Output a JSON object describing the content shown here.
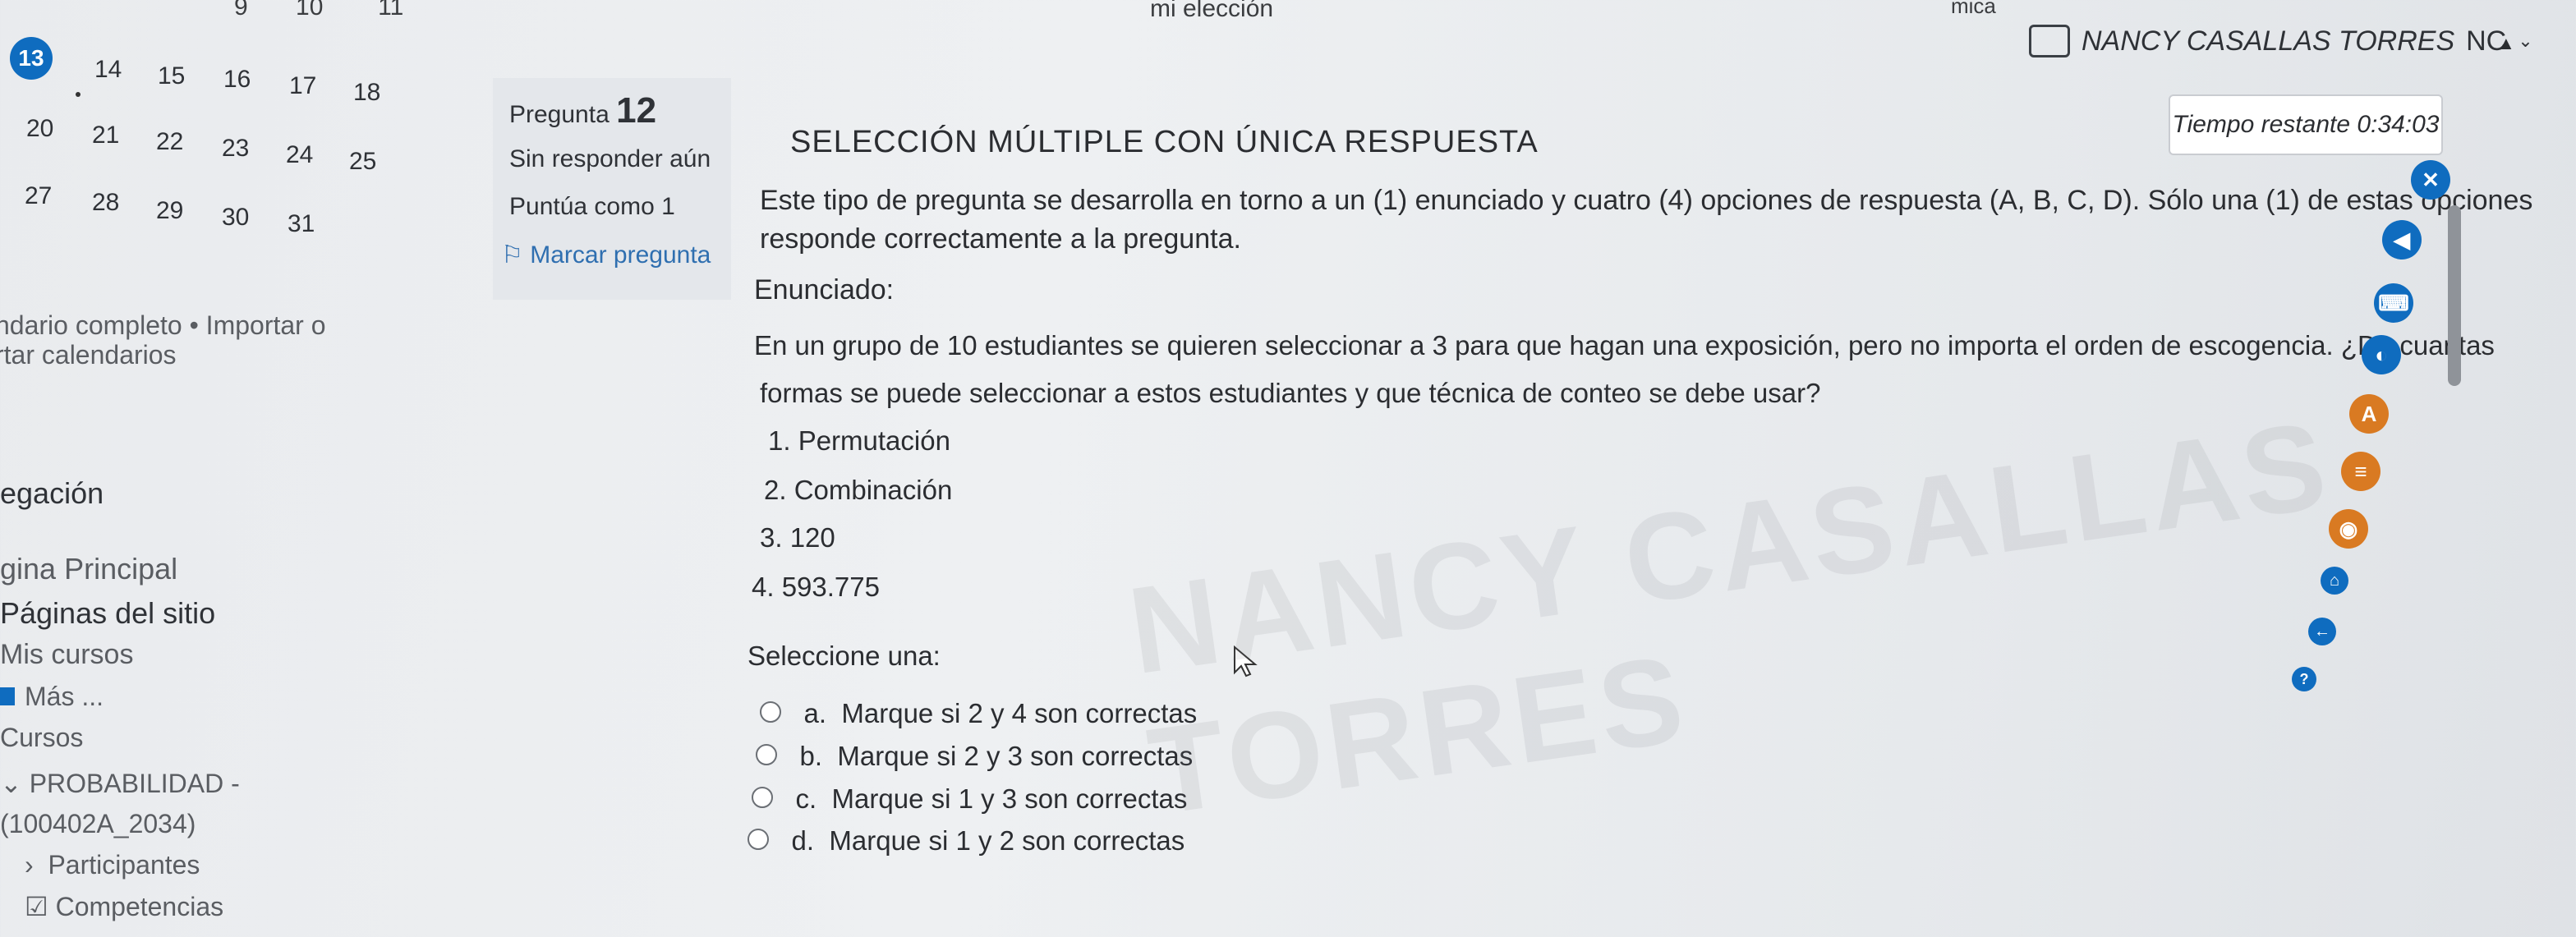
{
  "topbar": {
    "frag_numbers": [
      "9",
      "10",
      "11"
    ],
    "frag_title": "mi elección",
    "frag_left_menu": "mica",
    "user_name": "NANCY CASALLAS TORRES",
    "user_initials": "NC"
  },
  "calendar": {
    "today": "13",
    "row1": [
      "14",
      "15",
      "16",
      "17",
      "18"
    ],
    "row2": [
      "20",
      "21",
      "22",
      "23",
      "24",
      "25"
    ],
    "row3": [
      "27",
      "28",
      "29",
      "30",
      "31"
    ]
  },
  "sidebar": {
    "calendar_links": "ndario completo • Importar o",
    "calendar_links2": "rtar calendarios",
    "nav_title": "egación",
    "items": [
      {
        "label": "gina Principal"
      },
      {
        "label": "Páginas del sitio"
      },
      {
        "label": "Mis cursos"
      },
      {
        "label": "Más ..."
      },
      {
        "label": "Cursos"
      },
      {
        "label": "PROBABILIDAD -"
      },
      {
        "label": "(100402A_2034)"
      },
      {
        "label": "Participantes"
      },
      {
        "label": "Competencias"
      }
    ]
  },
  "question_info": {
    "label": "Pregunta",
    "number": "12",
    "status": "Sin responder aún",
    "score": "Puntúa como 1",
    "flag": "Marcar pregunta"
  },
  "question": {
    "heading": "SELECCIÓN MÚLTIPLE CON ÚNICA RESPUESTA",
    "intro1": "Este tipo de pregunta se desarrolla en torno a un (1) enunciado y cuatro (4) opciones de respuesta (A, B, C, D). Sólo una (1) de estas opciones",
    "intro2": "responde correctamente a la pregunta.",
    "statement_label": "Enunciado:",
    "statement1": "En un grupo de 10 estudiantes se quieren seleccionar a 3 para que hagan una exposición, pero no importa el orden de escogencia. ¿De cuantas",
    "statement2": "formas se puede seleccionar a estos estudiantes y que técnica de conteo se debe usar?",
    "list": [
      "1. Permutación",
      "2. Combinación",
      "3. 120",
      "4. 593.775"
    ],
    "select_prompt": "Seleccione una:",
    "options": [
      {
        "letter": "a.",
        "text": "Marque si 2 y 4 son correctas"
      },
      {
        "letter": "b.",
        "text": "Marque si 2 y 3 son correctas"
      },
      {
        "letter": "c.",
        "text": "Marque si 1 y 3 son correctas"
      },
      {
        "letter": "d.",
        "text": "Marque si 1 y 2 son correctas"
      }
    ]
  },
  "timer": {
    "label": "Tiempo restante",
    "value": "0:34:03"
  },
  "watermark": "NANCY CASALLAS TORRES",
  "colors": {
    "accent": "#0f6cbf",
    "orange": "#d97a22"
  }
}
